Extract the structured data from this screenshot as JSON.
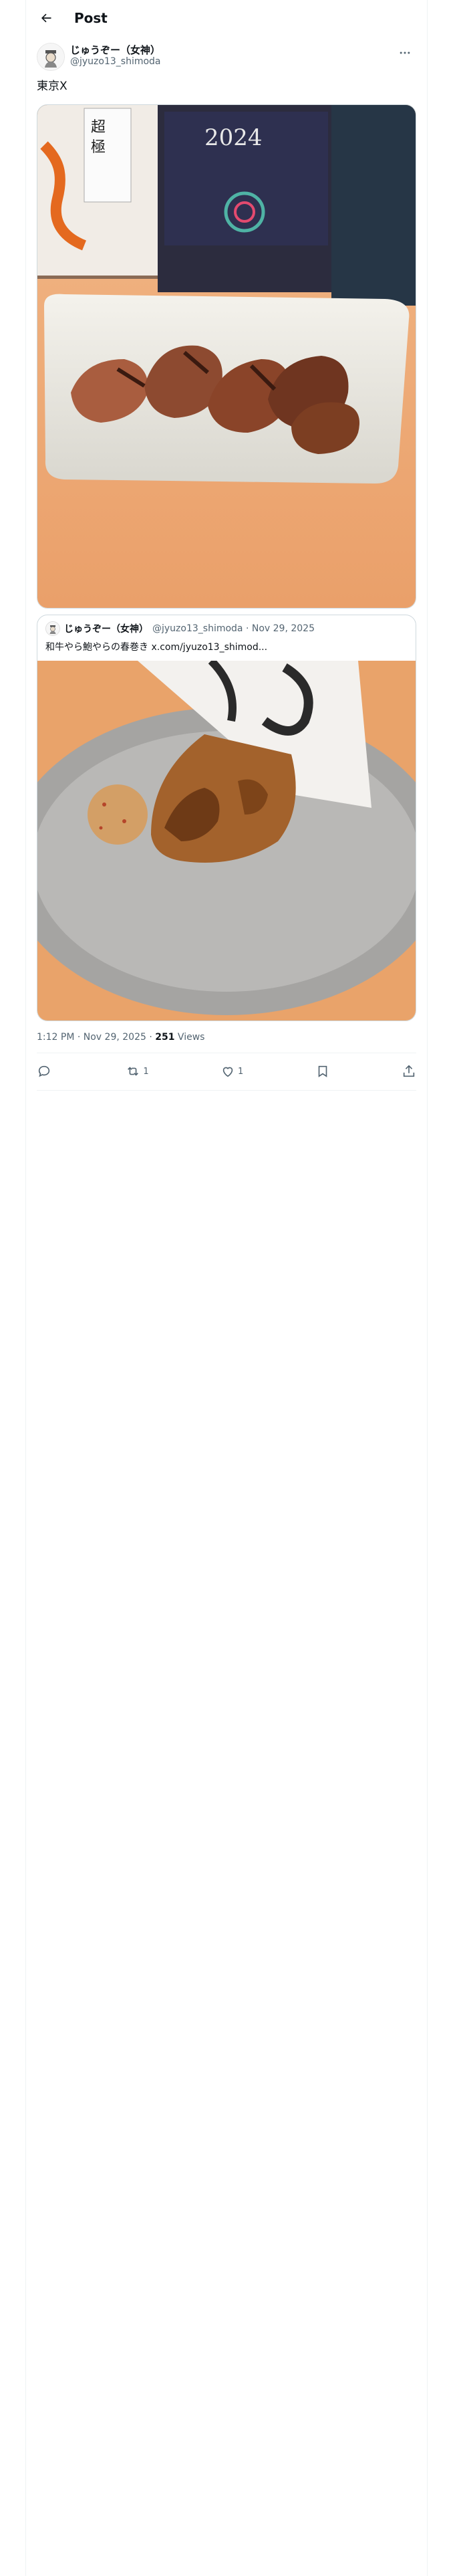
{
  "header": {
    "title": "Post"
  },
  "author": {
    "display_name": "じゅうぞー（女神）",
    "handle": "@jyuzo13_shimoda"
  },
  "tweet": {
    "text": "東京X"
  },
  "quote": {
    "display_name": "じゅうぞー（女神）",
    "meta": "@jyuzo13_shimoda · Nov 29, 2025",
    "text": "和牛やら鮑やらの春巻き",
    "link": "x.com/jyuzo13_shimod..."
  },
  "stats": {
    "timestamp": "1:12 PM · Nov 29, 2025 · ",
    "views_count": "251",
    "views_label": " Views"
  },
  "actions": {
    "reply_count": "",
    "repost_count": "1",
    "like_count": "1"
  },
  "bottle_label": "2024"
}
